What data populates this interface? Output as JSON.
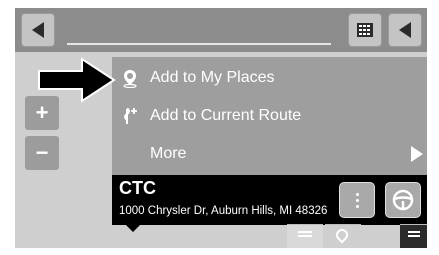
{
  "topbar": {
    "back_icon": "back-arrow-icon",
    "grid_icon": "keypad-icon",
    "nav_icon": "navigation-arrow-icon"
  },
  "zoom": {
    "in_label": "+",
    "out_label": "−"
  },
  "menu": {
    "items": [
      {
        "label": "Add to My Places",
        "icon": "place-pin-icon"
      },
      {
        "label": "Add to Current Route",
        "icon": "route-flag-icon"
      },
      {
        "label": "More",
        "icon": "chevron-right-icon"
      }
    ]
  },
  "location": {
    "title": "CTC",
    "address": "1000 Chrysler Dr, Auburn Hills, MI 48326"
  },
  "colors": {
    "bar": "#8c8c8c",
    "menu": "#9e9e9e",
    "info": "#000000"
  }
}
